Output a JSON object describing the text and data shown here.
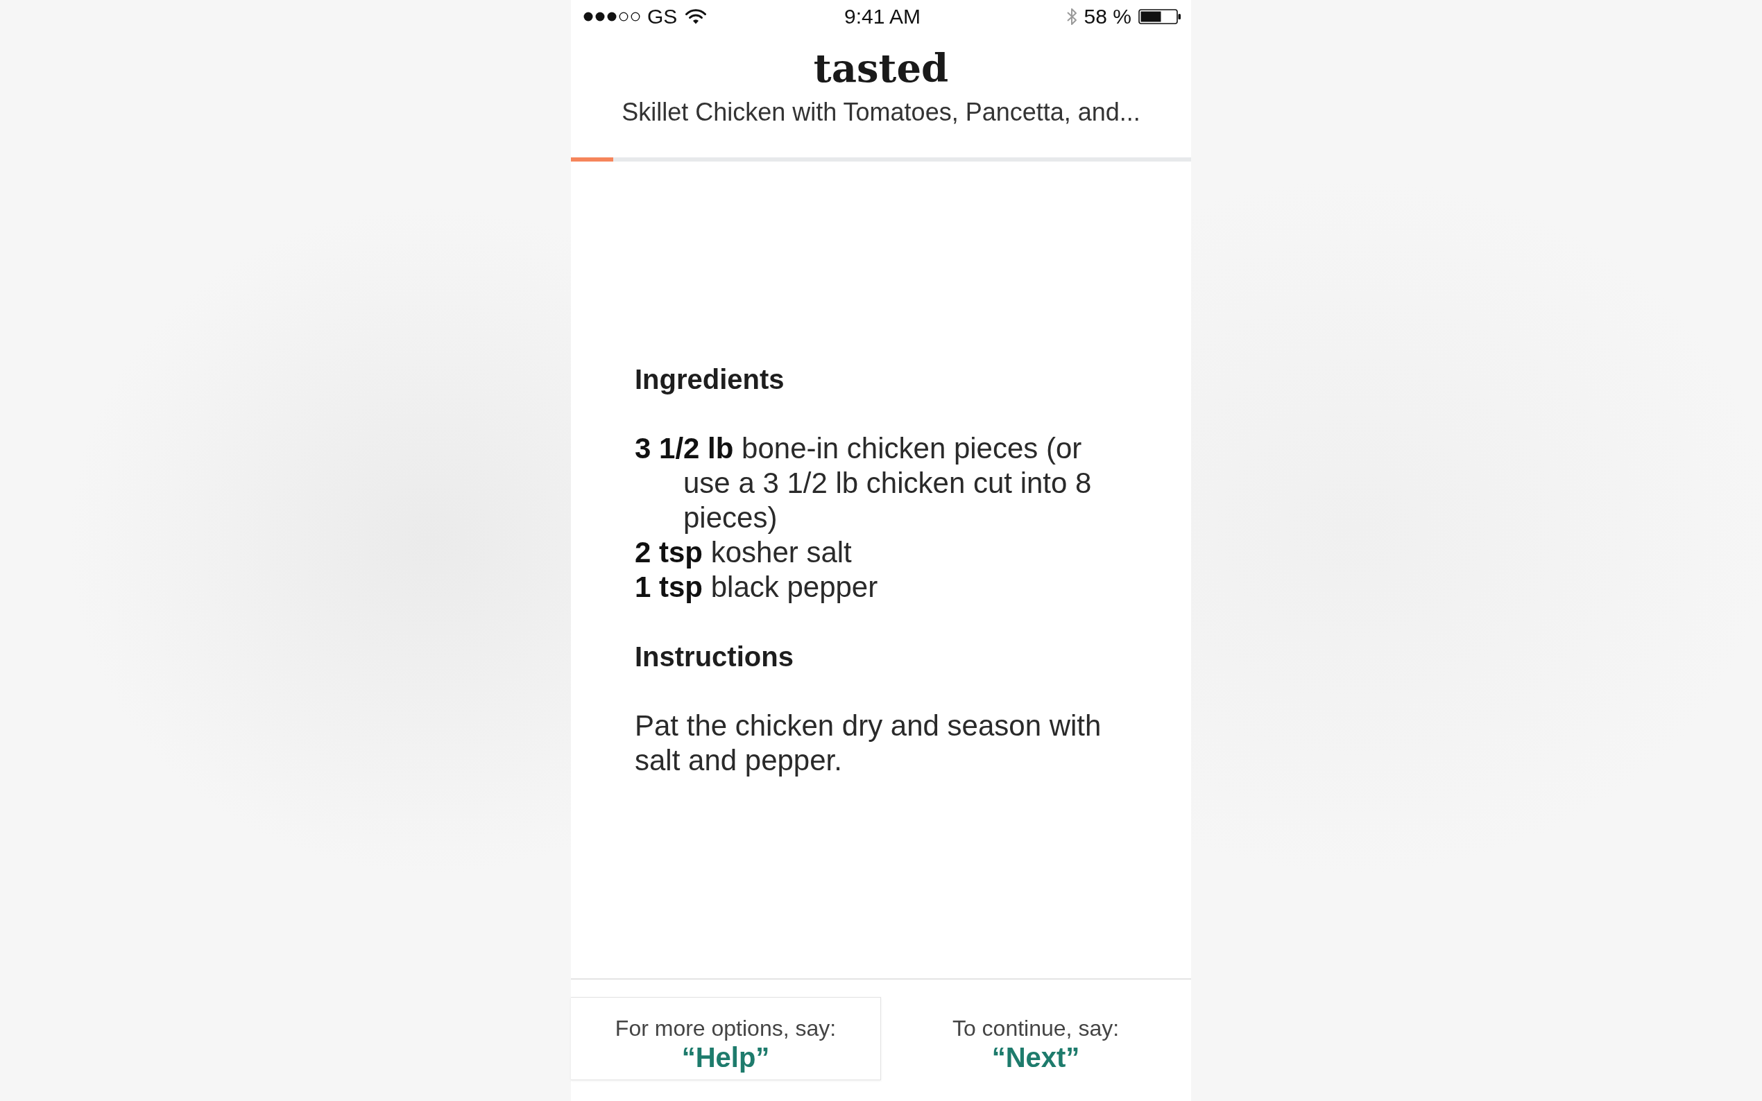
{
  "status_bar": {
    "carrier": "GS",
    "time": "9:41 AM",
    "battery": "58 %"
  },
  "header": {
    "logo": "tasted",
    "subtitle": "Skillet Chicken with Tomatoes, Pancetta, and..."
  },
  "progress": {
    "level": 0.068
  },
  "sections": [
    {
      "kind": "list",
      "heading": "Ingredients",
      "items": [
        "**3 1/2 lb** bone-in chicken pieces (or use a 3 1/2 lb chicken cut into 8 pieces)",
        "**2 tsp** kosher salt",
        "**1 tsp** black pepper"
      ]
    },
    {
      "kind": "paragraph",
      "heading": "Instructions",
      "text": "Pat the chicken dry and season with salt and pepper."
    }
  ],
  "footer": [
    {
      "prompt": "For more options, say:",
      "command": "“Help”",
      "selected": true
    },
    {
      "prompt": "To continue, say:",
      "command": "“Next”",
      "selected": false
    }
  ]
}
